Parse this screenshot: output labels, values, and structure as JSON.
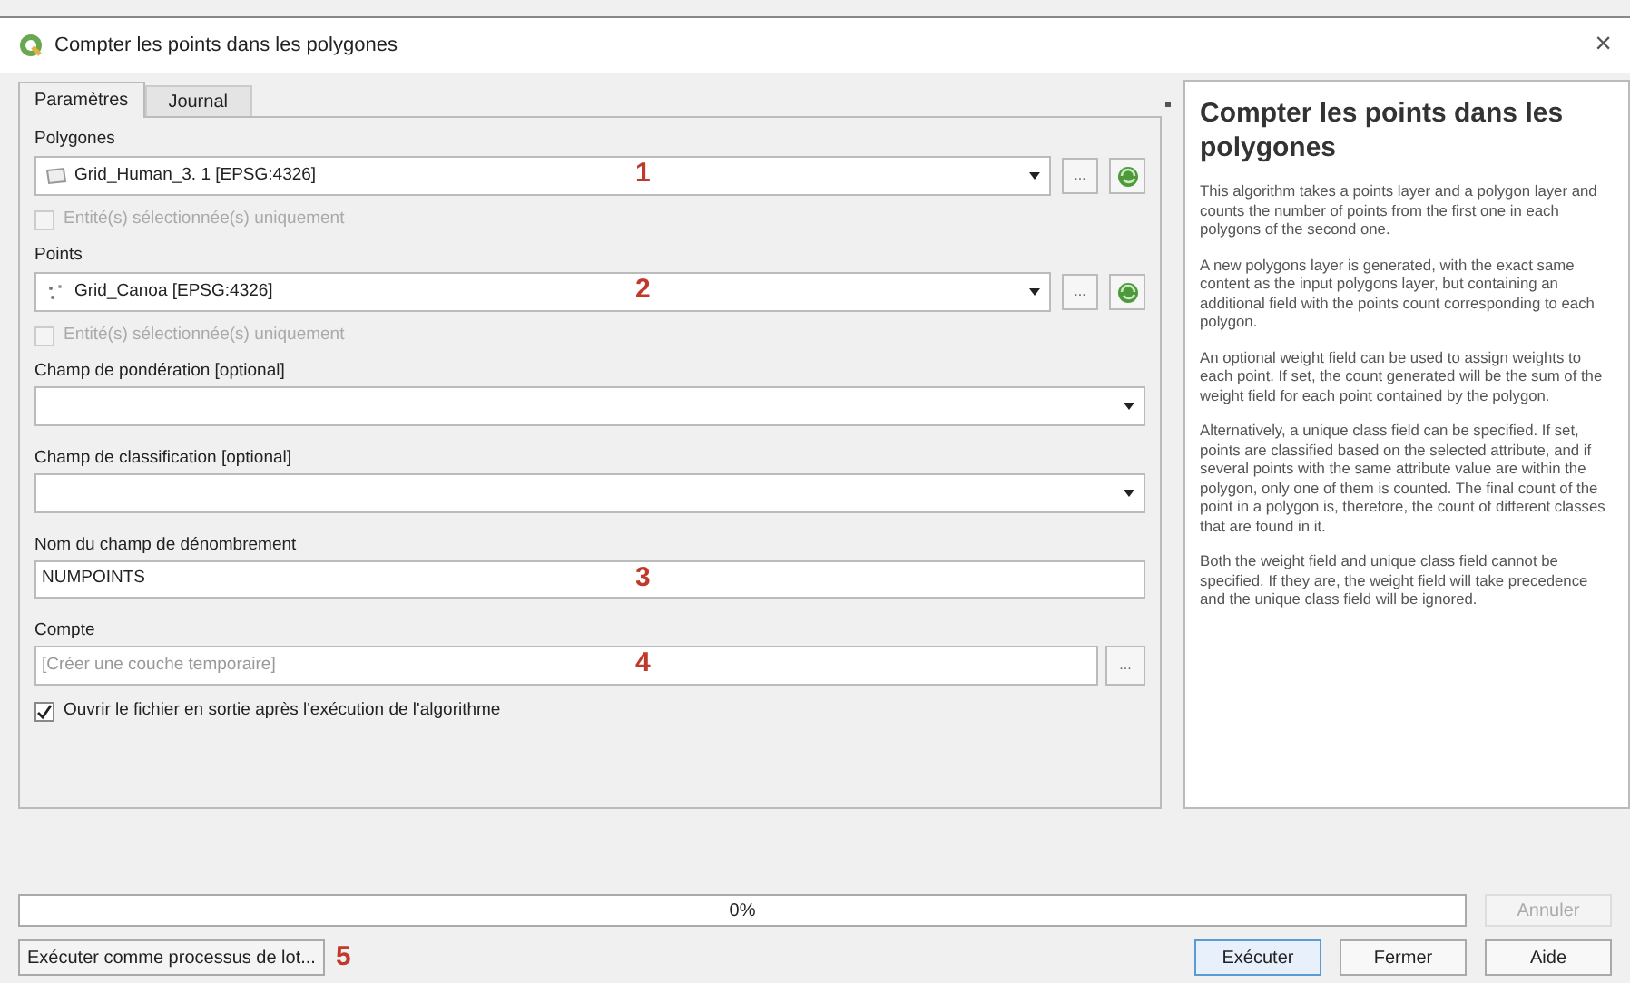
{
  "window": {
    "title": "Compter les points dans les polygones",
    "close": "×"
  },
  "tabs": [
    {
      "label": "Paramètres",
      "selected": true
    },
    {
      "label": "Journal",
      "selected": false
    }
  ],
  "parameters": [
    {
      "kind": "layer",
      "label": "Polygones",
      "value": "Grid_Human_3. 1 [EPSG:4326]",
      "icon": {
        "kind": "polygon"
      },
      "browse": "...",
      "annotation": "1",
      "option": {
        "label": "Entité(s) sélectionnée(s) uniquement",
        "checked": false,
        "disabled": true
      }
    },
    {
      "kind": "layer",
      "label": "Points",
      "value": "Grid_Canoa [EPSG:4326]",
      "icon": {
        "kind": "point"
      },
      "browse": "...",
      "annotation": "2",
      "option": {
        "label": "Entité(s) sélectionnée(s) uniquement",
        "checked": false,
        "disabled": true
      }
    },
    {
      "kind": "select",
      "label": "Champ de pondération [optional]"
    },
    {
      "kind": "select",
      "label": "Champ de classification [optional]"
    },
    {
      "kind": "text",
      "label": "Nom du champ de dénombrement",
      "value": "NUMPOINTS",
      "annotation": "3"
    },
    {
      "kind": "output",
      "label": "Compte",
      "placeholder": "[Créer une couche temporaire]",
      "annotation": "4",
      "browse": "..."
    },
    {
      "kind": "checkbox",
      "label": "Ouvrir le fichier en sortie après l'exécution de l'algorithme",
      "checked": true
    }
  ],
  "help": {
    "title": "Compter les points dans les polygones",
    "paragraphs": [
      "This algorithm takes a points layer and a polygon layer and counts the number of points from the first one in each polygons of the second one.",
      "A new polygons layer is generated, with the exact same content as the input polygons layer, but containing an additional field with the points count corresponding to each polygon.",
      "An optional weight field can be used to assign weights to each point. If set, the count generated will be the sum of the weight field for each point contained by the polygon.",
      "Alternatively, a unique class field can be specified. If set, points are classified based on the selected attribute, and if several points with the same attribute value are within the polygon, only one of them is counted. The final count of the point in a polygon is, therefore, the count of different classes that are found in it.",
      "Both the weight field and unique class field cannot be specified. If they are, the weight field will take precedence and the unique class field will be ignored."
    ]
  },
  "progress": {
    "level": 0,
    "text": "0%"
  },
  "cancel_button": {
    "label": "Annuler",
    "disabled": true
  },
  "batch_button": {
    "label": "Exécuter comme processus de lot...",
    "annotation": "5"
  },
  "buttons": [
    {
      "label": "Exécuter",
      "selected": true
    },
    {
      "label": "Fermer",
      "selected": false
    },
    {
      "label": "Aide",
      "selected": false
    }
  ]
}
